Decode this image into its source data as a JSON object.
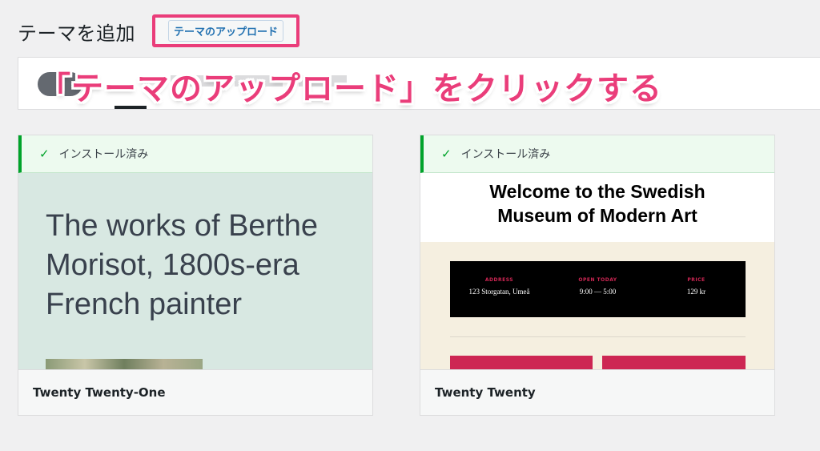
{
  "header": {
    "title": "テーマを追加",
    "upload_button": "テーマのアップロード"
  },
  "annotation": {
    "text": "「テーマのアップロード」をクリックする",
    "color": "#ea3d7a"
  },
  "themes": [
    {
      "name": "Twenty Twenty-One",
      "status": "インストール済み",
      "preview_heading": "The works of Berthe Morisot, 1800s-era French painter"
    },
    {
      "name": "Twenty Twenty",
      "status": "インストール済み",
      "preview_heading": "Welcome to the Swedish Museum of Modern Art",
      "info": [
        {
          "label": "ADDRESS",
          "value": "123 Storgatan, Umeå"
        },
        {
          "label": "OPEN TODAY",
          "value": "9:00 — 5:00"
        },
        {
          "label": "PRICE",
          "value": "129 kr"
        }
      ]
    }
  ],
  "colors": {
    "installed_green": "#00a32a",
    "link_blue": "#2271b1",
    "accent_red": "#cd2653"
  }
}
